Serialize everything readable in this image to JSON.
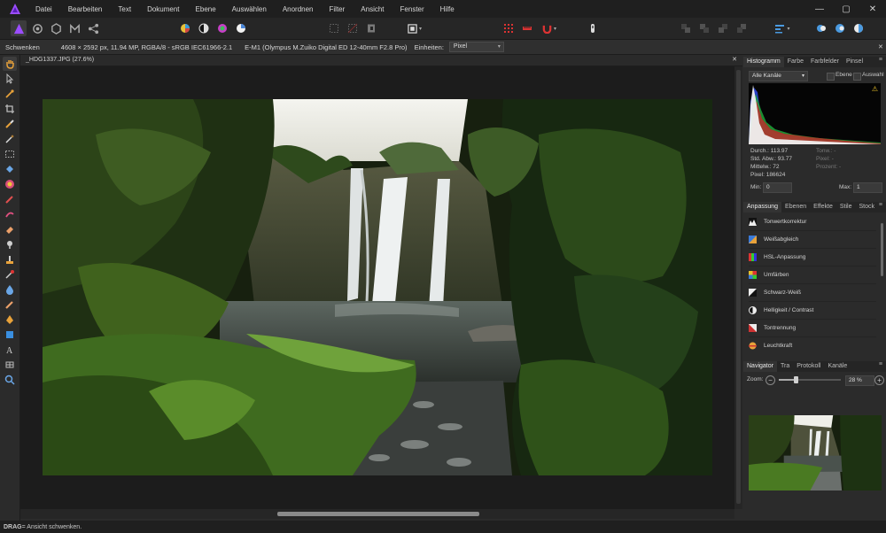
{
  "app": {
    "accent": "#9b4dff"
  },
  "menu": [
    "Datei",
    "Bearbeiten",
    "Text",
    "Dokument",
    "Ebene",
    "Auswählen",
    "Anordnen",
    "Filter",
    "Ansicht",
    "Fenster",
    "Hilfe"
  ],
  "window_controls": {
    "minimize": "—",
    "maximize": "▢",
    "close": "✕"
  },
  "context": {
    "tool_name": "Schwenken",
    "image_info": "4608 × 2592 px, 11.94 MP, RGBA/8 - sRGB IEC61966-2.1",
    "camera": "E-M1 (Olympus M.Zuiko Digital ED 12-40mm F2.8 Pro)",
    "units_label": "Einheiten:",
    "units_value": "Pixel"
  },
  "document": {
    "tab_title": "_HDG1337.JPG (27.6%)",
    "close": "✕"
  },
  "status": {
    "mod": "DRAG",
    "text": " = Ansicht schwenken."
  },
  "histogram_panel": {
    "tabs": [
      "Histogramm",
      "Farbe",
      "Farbfelder",
      "Pinsel"
    ],
    "channel": "Alle Kanäle",
    "layer_label": "Ebene",
    "selection_label": "Auswahl",
    "stats_left": [
      "Durch.: 113.97",
      "Std. Abw.: 93.77",
      "Mittelw.: 72",
      "Pixel: 186624"
    ],
    "stats_right": [
      "Tonw.:  -",
      "Pixel:  -",
      "Prozent:  -"
    ],
    "min_label": "Min:",
    "min_value": "0",
    "max_label": "Max:",
    "max_value": "1"
  },
  "adjust_panel": {
    "tabs": [
      "Anpassung",
      "Ebenen",
      "Effekte",
      "Stile",
      "Stock"
    ],
    "items": [
      {
        "label": "Tonwertkorrektur",
        "icon": "levels-icon"
      },
      {
        "label": "Weißabgleich",
        "icon": "white-balance-icon"
      },
      {
        "label": "HSL-Anpassung",
        "icon": "hsl-icon"
      },
      {
        "label": "Umfärben",
        "icon": "recolor-icon"
      },
      {
        "label": "Schwarz-Weiß",
        "icon": "black-white-icon"
      },
      {
        "label": "Helligkeit / Contrast",
        "icon": "brightness-contrast-icon"
      },
      {
        "label": "Tontrennung",
        "icon": "posterize-icon"
      },
      {
        "label": "Leuchtkraft",
        "icon": "vibrance-icon"
      }
    ]
  },
  "navigator_panel": {
    "tabs": [
      "Navigator",
      "Tra",
      "Protokoll",
      "Kanäle"
    ],
    "zoom_label": "Zoom:",
    "zoom_value": "28 %",
    "zoom_fraction": 0.28
  }
}
